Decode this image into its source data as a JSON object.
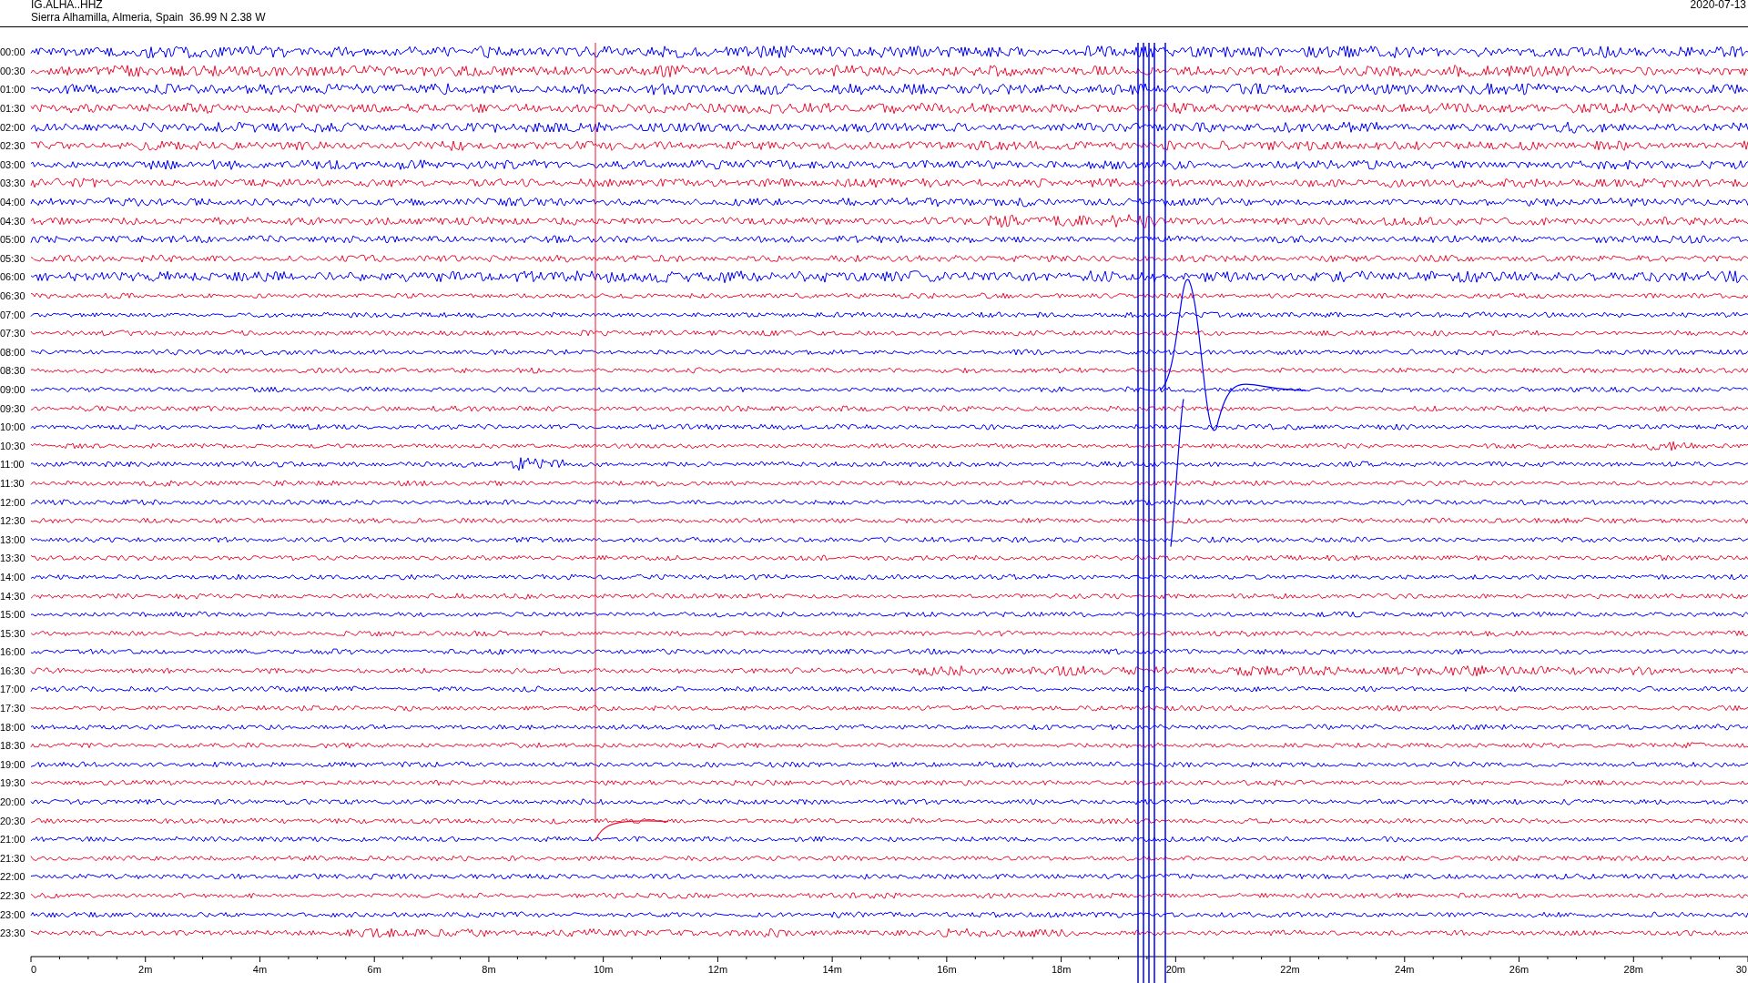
{
  "header": {
    "station": "IG.ALHA..HHZ",
    "location": "Sierra Alhamilla, Almeria, Spain  36.99 N 2.38 W",
    "date": "2020-07-13"
  },
  "traces": [
    {
      "label": "00:00",
      "color": "#0000ff"
    },
    {
      "label": "00:30",
      "color": "#ee1133"
    },
    {
      "label": "01:00",
      "color": "#0000ff"
    },
    {
      "label": "01:30",
      "color": "#ee1133"
    },
    {
      "label": "02:00",
      "color": "#0000ff"
    },
    {
      "label": "02:30",
      "color": "#ee1133"
    },
    {
      "label": "03:00",
      "color": "#0000ff"
    },
    {
      "label": "03:30",
      "color": "#ee1133"
    },
    {
      "label": "04:00",
      "color": "#0000ff"
    },
    {
      "label": "04:30",
      "color": "#ee1133"
    },
    {
      "label": "05:00",
      "color": "#0000ff"
    },
    {
      "label": "05:30",
      "color": "#ee1133"
    },
    {
      "label": "06:00",
      "color": "#0000ff"
    },
    {
      "label": "06:30",
      "color": "#ee1133"
    },
    {
      "label": "07:00",
      "color": "#0000ff"
    },
    {
      "label": "07:30",
      "color": "#ee1133"
    },
    {
      "label": "08:00",
      "color": "#0000ff"
    },
    {
      "label": "08:30",
      "color": "#ee1133"
    },
    {
      "label": "09:00",
      "color": "#0000ff"
    },
    {
      "label": "09:30",
      "color": "#ee1133"
    },
    {
      "label": "10:00",
      "color": "#0000ff"
    },
    {
      "label": "10:30",
      "color": "#ee1133"
    },
    {
      "label": "11:00",
      "color": "#0000ff"
    },
    {
      "label": "11:30",
      "color": "#ee1133"
    },
    {
      "label": "12:00",
      "color": "#0000ff"
    },
    {
      "label": "12:30",
      "color": "#ee1133"
    },
    {
      "label": "13:00",
      "color": "#0000ff"
    },
    {
      "label": "13:30",
      "color": "#ee1133"
    },
    {
      "label": "14:00",
      "color": "#0000ff"
    },
    {
      "label": "14:30",
      "color": "#ee1133"
    },
    {
      "label": "15:00",
      "color": "#0000ff"
    },
    {
      "label": "15:30",
      "color": "#ee1133"
    },
    {
      "label": "16:00",
      "color": "#0000ff"
    },
    {
      "label": "16:30",
      "color": "#ee1133"
    },
    {
      "label": "17:00",
      "color": "#0000ff"
    },
    {
      "label": "17:30",
      "color": "#ee1133"
    },
    {
      "label": "18:00",
      "color": "#0000ff"
    },
    {
      "label": "18:30",
      "color": "#ee1133"
    },
    {
      "label": "19:00",
      "color": "#0000ff"
    },
    {
      "label": "19:30",
      "color": "#ee1133"
    },
    {
      "label": "20:00",
      "color": "#0000ff"
    },
    {
      "label": "20:30",
      "color": "#ee1133"
    },
    {
      "label": "21:00",
      "color": "#0000ff"
    },
    {
      "label": "21:30",
      "color": "#ee1133"
    },
    {
      "label": "22:00",
      "color": "#0000ff"
    },
    {
      "label": "22:30",
      "color": "#ee1133"
    },
    {
      "label": "23:00",
      "color": "#0000ff"
    },
    {
      "label": "23:30",
      "color": "#ee1133"
    }
  ],
  "axis": {
    "ticks": [
      "0",
      "2m",
      "4m",
      "6m",
      "8m",
      "10m",
      "12m",
      "14m",
      "16m",
      "18m",
      "20m",
      "22m",
      "24m",
      "26m",
      "28m",
      "30"
    ]
  }
}
